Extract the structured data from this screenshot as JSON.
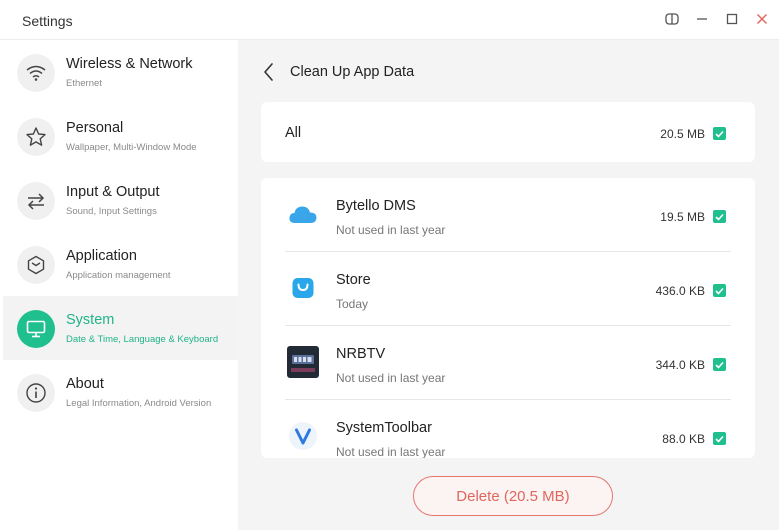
{
  "window": {
    "title": "Settings",
    "icons": [
      "split-view-icon",
      "minimize-icon",
      "maximize-icon",
      "close-icon"
    ]
  },
  "colors": {
    "accent": "#20bf8e",
    "danger": "#e0665d",
    "panel_bg": "#f4f4f4"
  },
  "sidebar": {
    "items": [
      {
        "label": "Wireless & Network",
        "sub": "Ethernet",
        "icon": "wifi-icon",
        "active": false
      },
      {
        "label": "Personal",
        "sub": "Wallpaper, Multi-Window Mode",
        "icon": "star-icon",
        "active": false
      },
      {
        "label": "Input & Output",
        "sub": "Sound, Input Settings",
        "icon": "swap-arrows-icon",
        "active": false
      },
      {
        "label": "Application",
        "sub": "Application management",
        "icon": "cube-icon",
        "active": false
      },
      {
        "label": "System",
        "sub": "Date & Time, Language & Keyboard",
        "icon": "monitor-icon",
        "active": true
      },
      {
        "label": "About",
        "sub": "Legal Information, Android Version",
        "icon": "info-icon",
        "active": false
      }
    ]
  },
  "main": {
    "title": "Clean Up App Data",
    "all": {
      "label": "All",
      "size": "20.5 MB",
      "checked": true
    },
    "apps": [
      {
        "name": "Bytello DMS",
        "sub": "Not used in last year",
        "size": "19.5 MB",
        "checked": true,
        "icon": "cloud-app-icon"
      },
      {
        "name": "Store",
        "sub": "Today",
        "size": "436.0 KB",
        "checked": true,
        "icon": "store-bag-icon"
      },
      {
        "name": "NRBTV",
        "sub": "Not used in last year",
        "size": "344.0 KB",
        "checked": true,
        "icon": "nrbtv-app-icon"
      },
      {
        "name": "SystemToolbar",
        "sub": "Not used in last year",
        "size": "88.0 KB",
        "checked": true,
        "icon": "v-logo-icon"
      }
    ],
    "delete_label": "Delete (20.5 MB)"
  }
}
